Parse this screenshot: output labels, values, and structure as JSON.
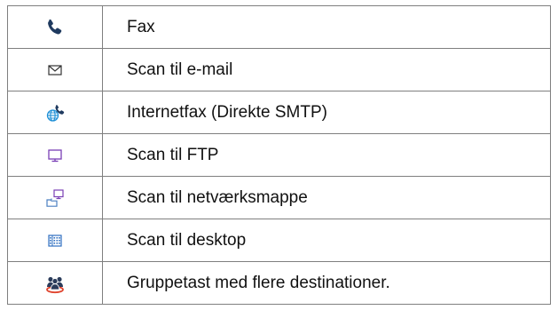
{
  "rows": [
    {
      "icon": "phone-icon",
      "label": "Fax"
    },
    {
      "icon": "envelope-icon",
      "label": "Scan til e-mail"
    },
    {
      "icon": "globe-phone-icon",
      "label": "Internetfax (Direkte SMTP)"
    },
    {
      "icon": "monitor-icon",
      "label": "Scan til FTP"
    },
    {
      "icon": "network-folder-icon",
      "label": "Scan til netværksmappe"
    },
    {
      "icon": "desktop-grid-icon",
      "label": "Scan til desktop"
    },
    {
      "icon": "group-icon",
      "label": "Gruppetast med flere destinationer."
    }
  ],
  "colors": {
    "phone": "#1f3a5f",
    "envelope": "#333333",
    "globe": "#1d8fd6",
    "monitor": "#7a3fb5",
    "network": "#4a7fc1",
    "desktop": "#2f6fc0",
    "group_people": "#2a3b5a",
    "group_ring": "#e0442e",
    "border": "#7f7f7f"
  }
}
